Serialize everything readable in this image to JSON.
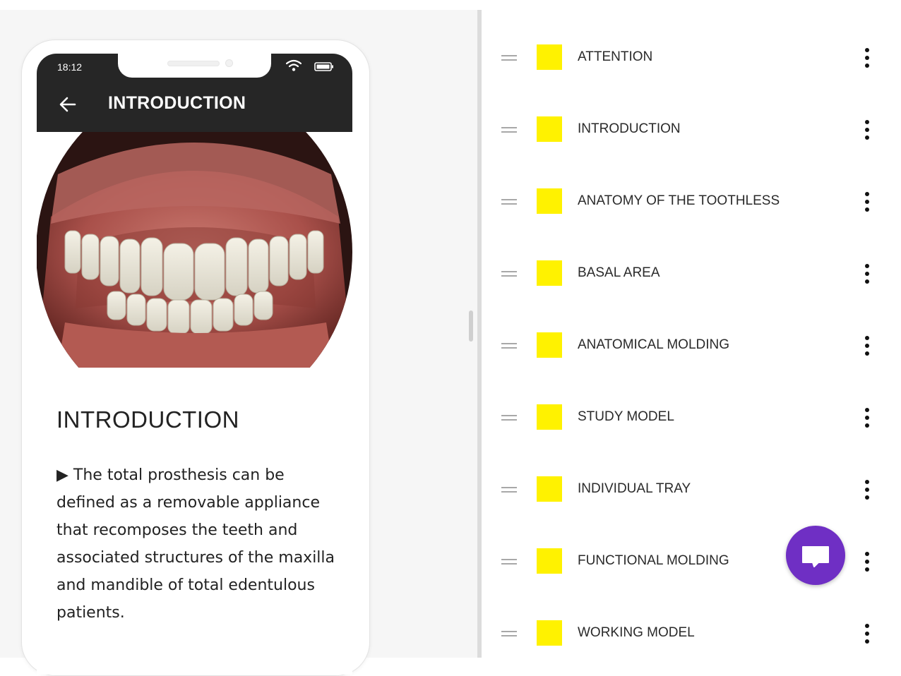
{
  "phone": {
    "status_time": "18:12",
    "app_bar_title": "INTRODUCTION",
    "back_icon": "arrow-left",
    "wifi_icon": "wifi",
    "battery_icon": "battery"
  },
  "content": {
    "heading": "INTRODUCTION",
    "body": "▶ The total prosthesis can be defined as a removable appliance that recomposes the teeth and associated structures of the maxilla and mandible of total edentulous patients."
  },
  "chapters": [
    {
      "label": "ATTENTION",
      "color": "#fff200"
    },
    {
      "label": "INTRODUCTION",
      "color": "#fff200"
    },
    {
      "label": "ANATOMY OF THE TOOTHLESS",
      "color": "#fff200"
    },
    {
      "label": "BASAL AREA",
      "color": "#fff200"
    },
    {
      "label": "ANATOMICAL MOLDING",
      "color": "#fff200"
    },
    {
      "label": "STUDY MODEL",
      "color": "#fff200"
    },
    {
      "label": "INDIVIDUAL TRAY",
      "color": "#fff200"
    },
    {
      "label": "FUNCTIONAL MOLDING",
      "color": "#fff200"
    },
    {
      "label": "WORKING MODEL",
      "color": "#fff200"
    }
  ],
  "icons": {
    "drag_handle": "drag-handle-icon",
    "more": "more-vertical-icon",
    "chat": "chat-icon"
  },
  "colors": {
    "app_bar": "#262626",
    "accent_fab": "#6f2fc4",
    "swatch": "#fff200"
  }
}
